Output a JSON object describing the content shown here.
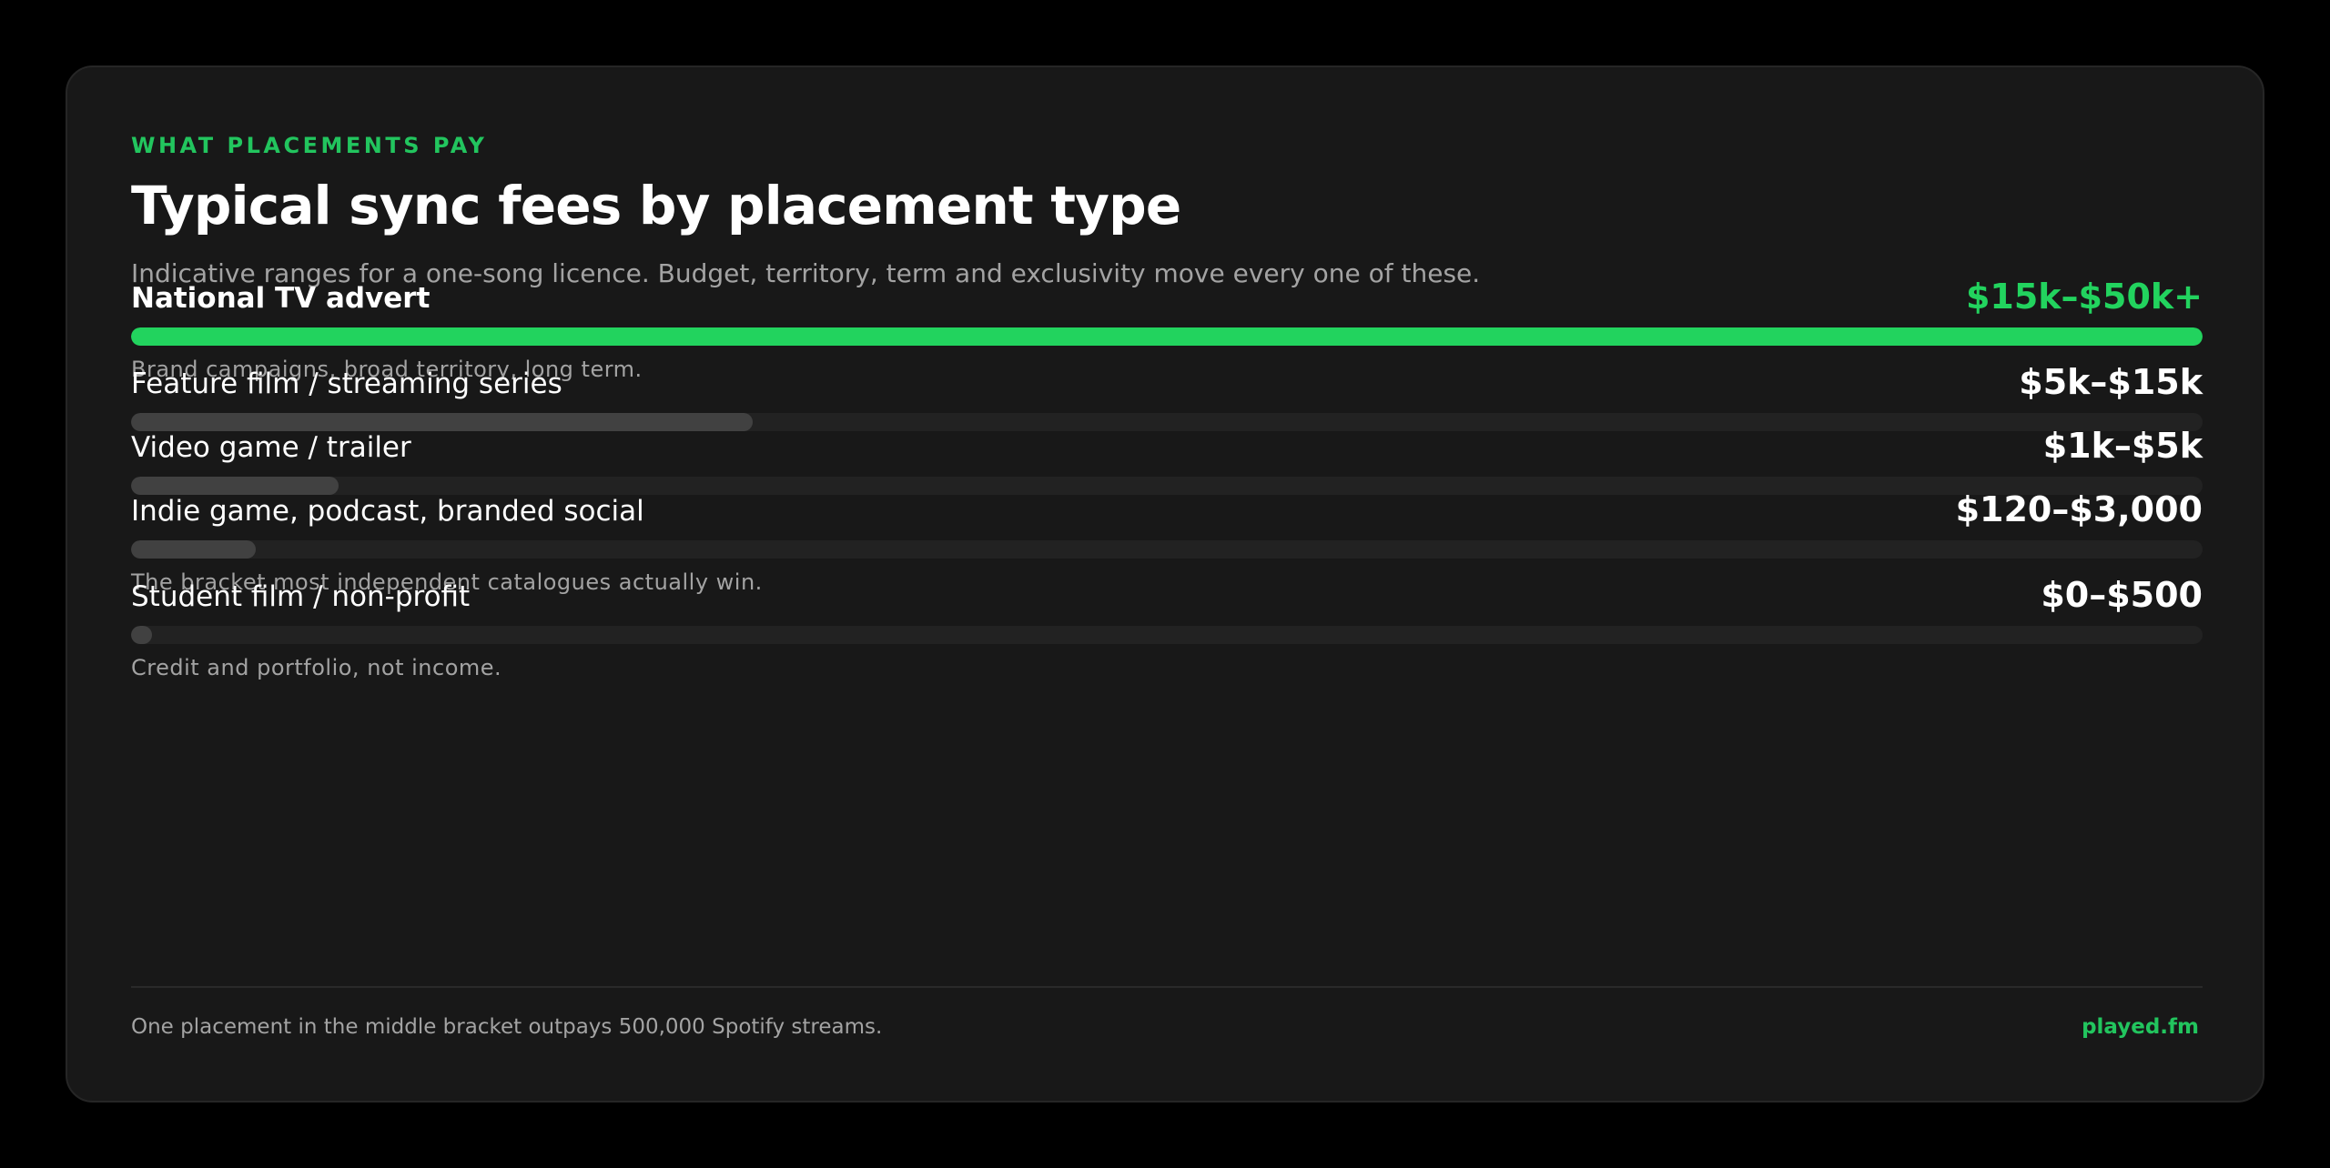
{
  "header": {
    "eyebrow": "WHAT PLACEMENTS PAY",
    "title": "Typical sync fees by placement type",
    "subtitle": "Indicative ranges for a one-song licence. Budget, territory, term and exclusivity move every one of these."
  },
  "chart_data": {
    "type": "bar",
    "orientation": "horizontal",
    "xlim": [
      0,
      1
    ],
    "grid": false,
    "legend": "none",
    "categories": [
      "National TV advert",
      "Feature film / streaming series",
      "Video game / trailer",
      "Indie game, podcast, branded social",
      "Student film / non-profit"
    ],
    "values": [
      1.0,
      0.3,
      0.1,
      0.06,
      0.01
    ],
    "value_labels": [
      "$15k–$50k+",
      "$5k–$15k",
      "$1k–$5k",
      "$120–$3,000",
      "$0–$500"
    ],
    "notes": [
      "Brand campaigns, broad territory, long term.",
      "",
      "",
      "The bracket most independent catalogues actually win.",
      "Credit and portfolio, not income."
    ],
    "highlight_index": 0
  },
  "footer": {
    "note": "One placement in the middle bracket outpays 500,000 Spotify streams.",
    "brand": "played.fm"
  },
  "colors": {
    "accent": "#22d35e",
    "bar_muted": "#414141",
    "track": "#222222",
    "card": "#181818",
    "background": "#000000"
  }
}
